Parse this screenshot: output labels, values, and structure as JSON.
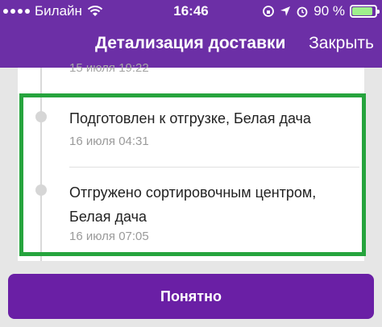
{
  "status_bar": {
    "carrier": "Билайн",
    "time": "16:46",
    "battery": "90 %",
    "battery_level": 0.9
  },
  "header": {
    "title": "Детализация доставки",
    "close_label": "Закрыть"
  },
  "timeline": {
    "previous_time": "15 июля 19:22",
    "events": [
      {
        "title": "Подготовлен к отгрузке, Белая дача",
        "time": "16 июля 04:31"
      },
      {
        "title": "Отгружено сортировочным центром, Белая дача",
        "time": "16 июля 07:05"
      }
    ]
  },
  "actions": {
    "ok_label": "Понятно"
  },
  "colors": {
    "header": "#6c2fa6",
    "button": "#6a1fa5",
    "highlight": "#26a43d",
    "battery": "#9ff08c"
  }
}
